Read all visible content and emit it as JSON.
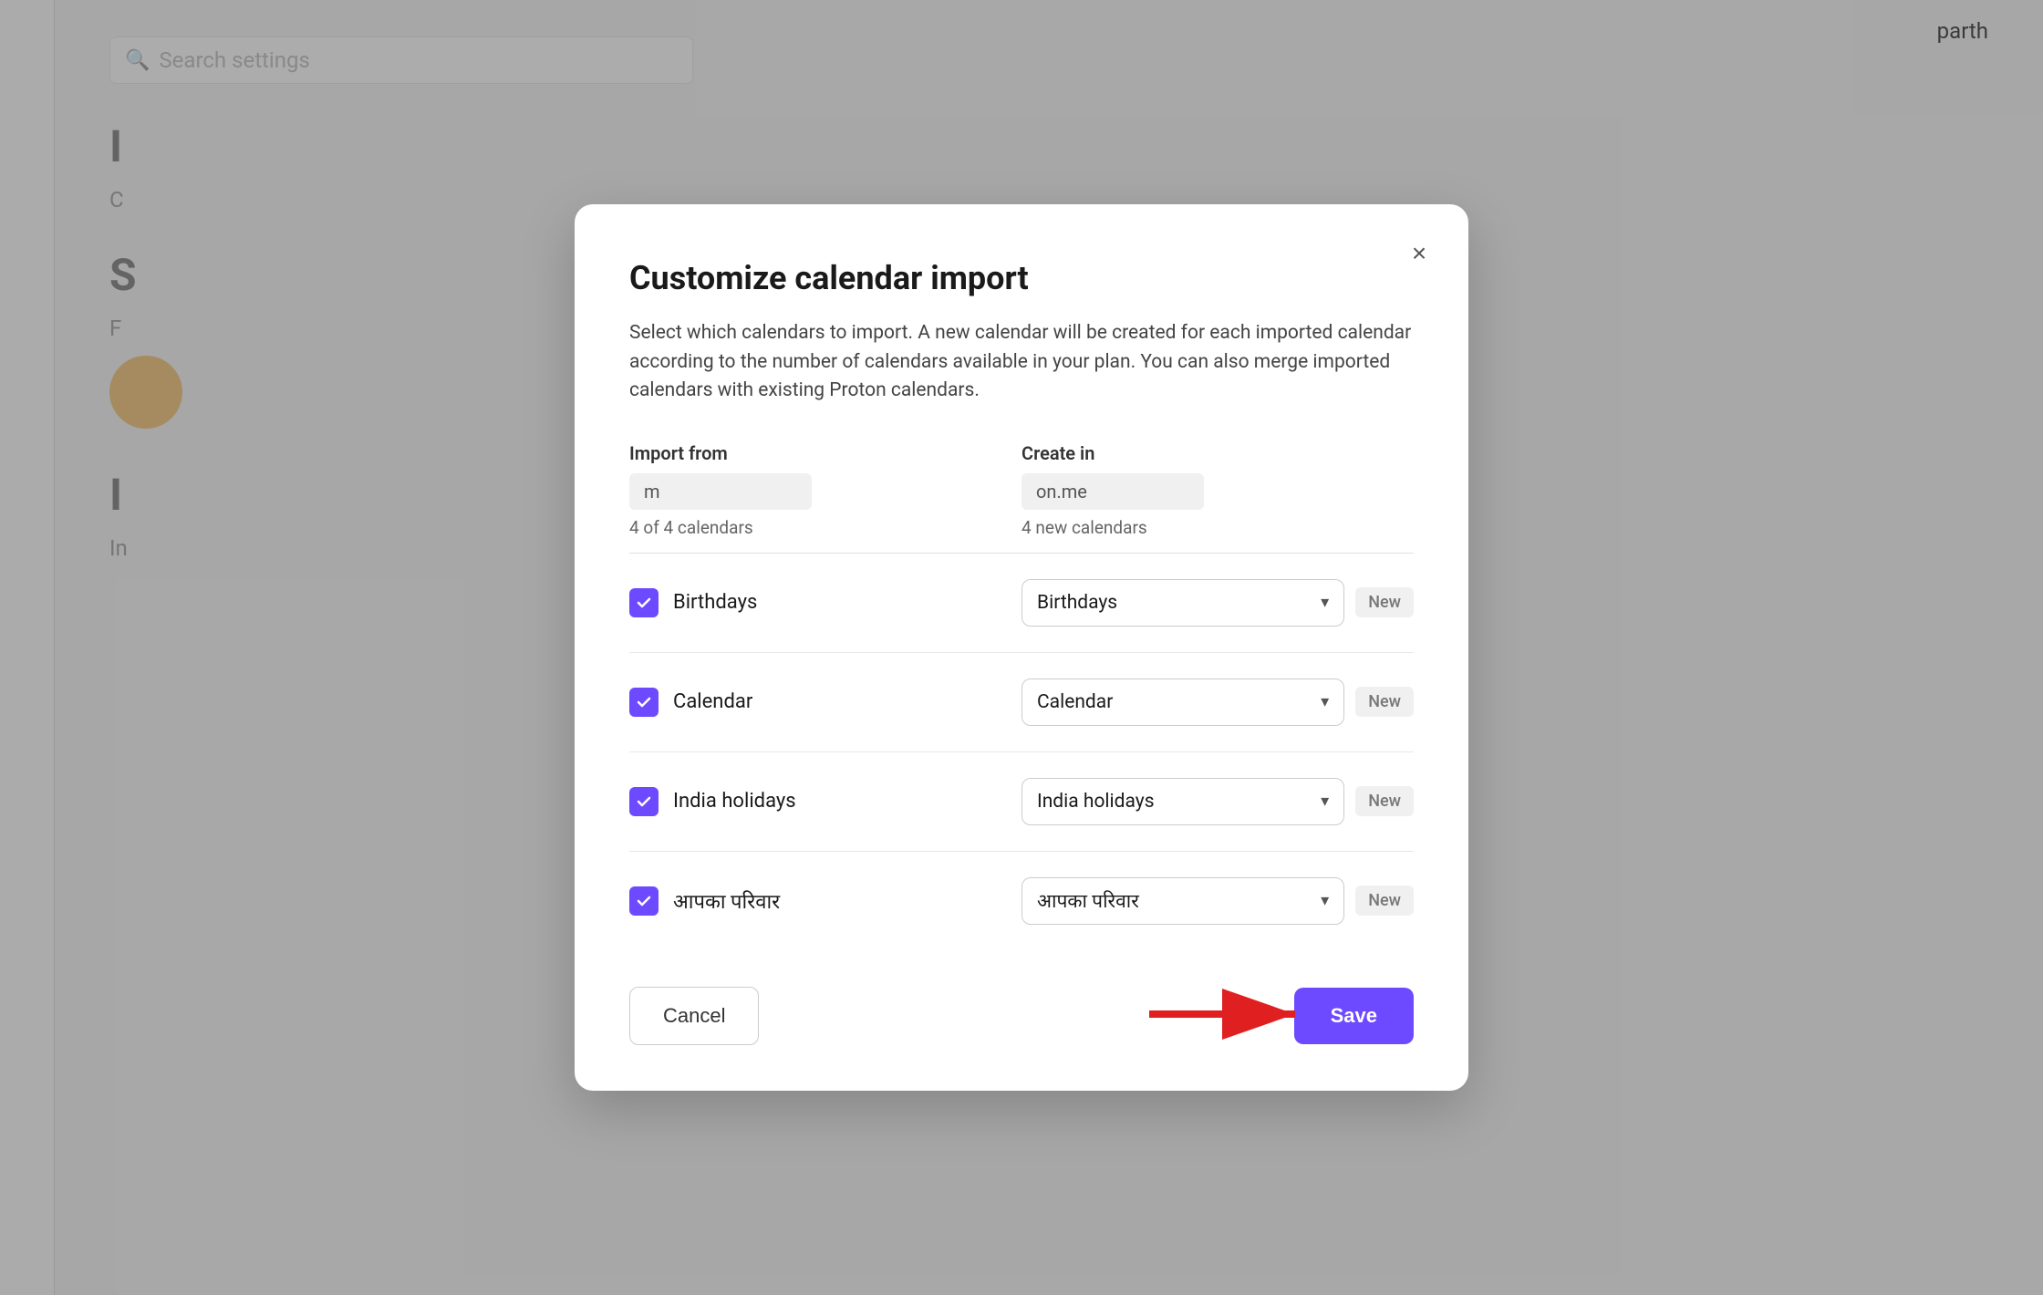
{
  "background": {
    "search_placeholder": "Search settings",
    "username": "parth",
    "headings": [
      "I",
      "S",
      "I"
    ],
    "subtext": [
      "C",
      "F",
      "In"
    ],
    "avatar_color": "#e8a020"
  },
  "modal": {
    "title": "Customize calendar import",
    "description": "Select which calendars to import. A new calendar will be created for each imported calendar according to the number of calendars available in your plan. You can also merge imported calendars with existing Proton calendars.",
    "import_from_label": "Import from",
    "create_in_label": "Create in",
    "import_source": "m",
    "create_destination": "on.me",
    "import_count": "4 of 4 calendars",
    "create_count": "4 new calendars",
    "calendars": [
      {
        "id": "birthdays",
        "name": "Birthdays",
        "checked": true,
        "dropdown_value": "Birthdays",
        "badge": "New"
      },
      {
        "id": "calendar",
        "name": "Calendar",
        "checked": true,
        "dropdown_value": "Calendar",
        "badge": "New"
      },
      {
        "id": "india-holidays",
        "name": "India holidays",
        "checked": true,
        "dropdown_value": "India holidays",
        "badge": "New"
      },
      {
        "id": "aapka-pariwar",
        "name": "आपका परिवार",
        "checked": true,
        "dropdown_value": "आपका परिवार",
        "badge": "New"
      }
    ],
    "cancel_label": "Cancel",
    "save_label": "Save",
    "close_label": "×"
  }
}
